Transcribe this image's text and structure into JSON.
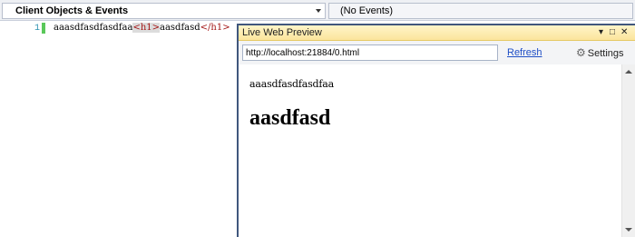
{
  "nav": {
    "left_combo": "Client Objects & Events",
    "right_combo": "(No Events)"
  },
  "editor": {
    "line_number": "1",
    "code_text_plain": "aaasdfasdfasdfaa",
    "code_open_tag": "<h1>",
    "code_h1_text": "aasdfasd",
    "code_close_tag": "</h1>"
  },
  "preview": {
    "title": "Live Web Preview",
    "controls": {
      "pin": "▾",
      "maximize": "□",
      "close": "✕"
    },
    "url": "http://localhost:21884/0.html",
    "refresh_label": "Refresh",
    "settings_label": "Settings",
    "settings_icon": "gear-icon",
    "paragraph": "aaasdfasdfasdfaa",
    "heading": "aasdfasd"
  },
  "colors": {
    "title_bar": "#fbe59c",
    "window_border": "#40577d",
    "link": "#1f4fc6",
    "change_marker": "#5ac85a"
  }
}
